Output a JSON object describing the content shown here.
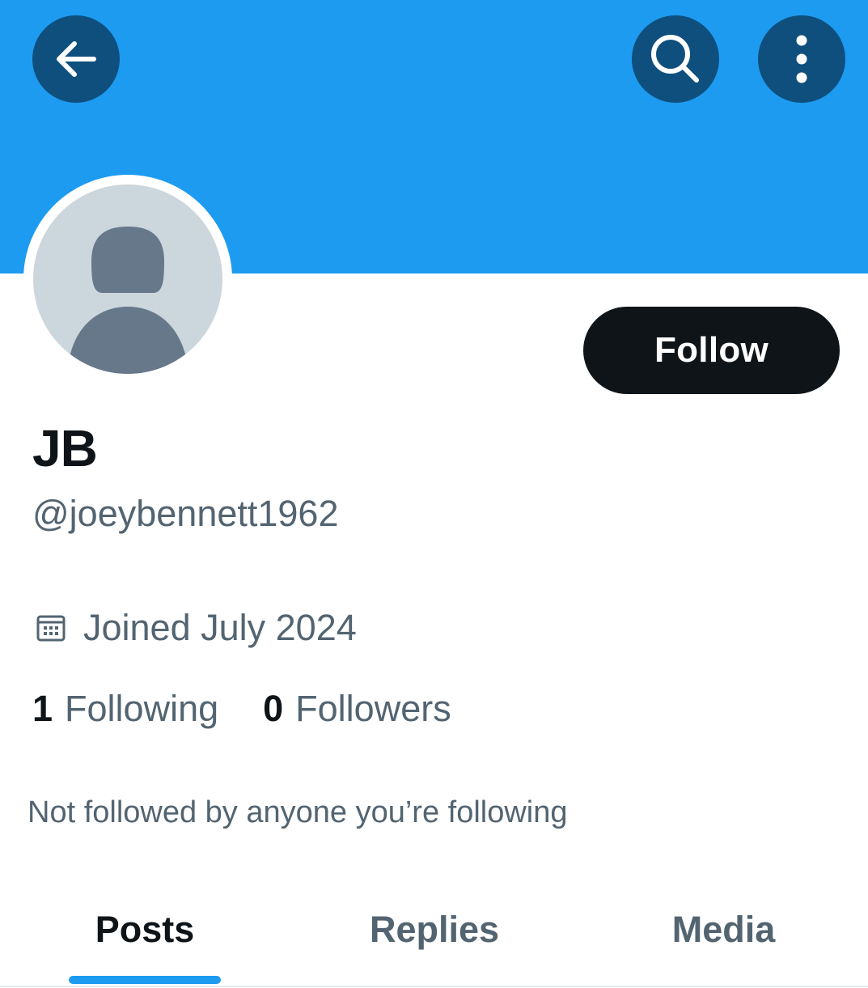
{
  "header": {
    "back_icon": "arrow-left-icon",
    "search_icon": "search-icon",
    "more_icon": "more-vertical-icon",
    "banner_color": "#1d9bf0"
  },
  "profile": {
    "avatar": "default-avatar",
    "display_name": "JB",
    "handle": "@joeybennett1962",
    "joined": "Joined July 2024",
    "follow_label": "Follow",
    "following_count": "1",
    "following_label": "Following",
    "followers_count": "0",
    "followers_label": "Followers",
    "not_followed_text": "Not followed by anyone you’re following"
  },
  "tabs": [
    {
      "label": "Posts",
      "selected": true
    },
    {
      "label": "Replies",
      "selected": false
    },
    {
      "label": "Media",
      "selected": false
    }
  ],
  "colors": {
    "accent": "#1d9bf0",
    "primary_text": "#0f1419",
    "secondary_text": "#536471",
    "header_button": "#0f4f7d"
  }
}
